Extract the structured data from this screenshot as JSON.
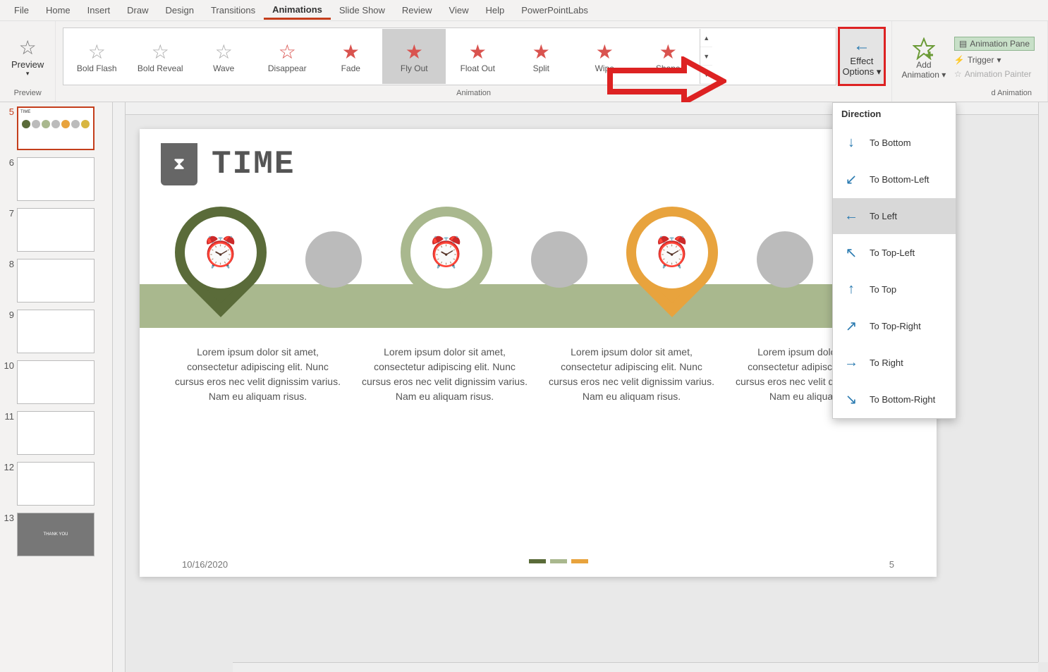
{
  "menu": {
    "file": "File",
    "home": "Home",
    "insert": "Insert",
    "draw": "Draw",
    "design": "Design",
    "transitions": "Transitions",
    "animations": "Animations",
    "slideshow": "Slide Show",
    "review": "Review",
    "view": "View",
    "help": "Help",
    "labs": "PowerPointLabs"
  },
  "ribbon": {
    "preview": "Preview",
    "preview_grp": "Preview",
    "anims": [
      "Bold Flash",
      "Bold Reveal",
      "Wave",
      "Disappear",
      "Fade",
      "Fly Out",
      "Float Out",
      "Split",
      "Wipe",
      "Shape"
    ],
    "anim_grp": "Animation",
    "effect_options_l1": "Effect",
    "effect_options_l2": "Options",
    "add_anim_l1": "Add",
    "add_anim_l2": "Animation",
    "pane": "Animation Pane",
    "trigger": "Trigger",
    "painter": "Animation Painter",
    "adv_grp": "Advanced Animation"
  },
  "directions": {
    "hdr": "Direction",
    "items": [
      "To Bottom",
      "To Bottom-Left",
      "To Left",
      "To Top-Left",
      "To Top",
      "To Top-Right",
      "To Right",
      "To Bottom-Right"
    ],
    "selected": 2
  },
  "thumbs": {
    "start": 5,
    "count": 9,
    "active": 5
  },
  "slide": {
    "title": "TIME",
    "body": "Lorem ipsum dolor sit amet, consectetur adipiscing elit. Nunc cursus eros nec velit dignissim varius. Nam eu aliquam risus.",
    "date": "10/16/2020",
    "page": "5"
  }
}
